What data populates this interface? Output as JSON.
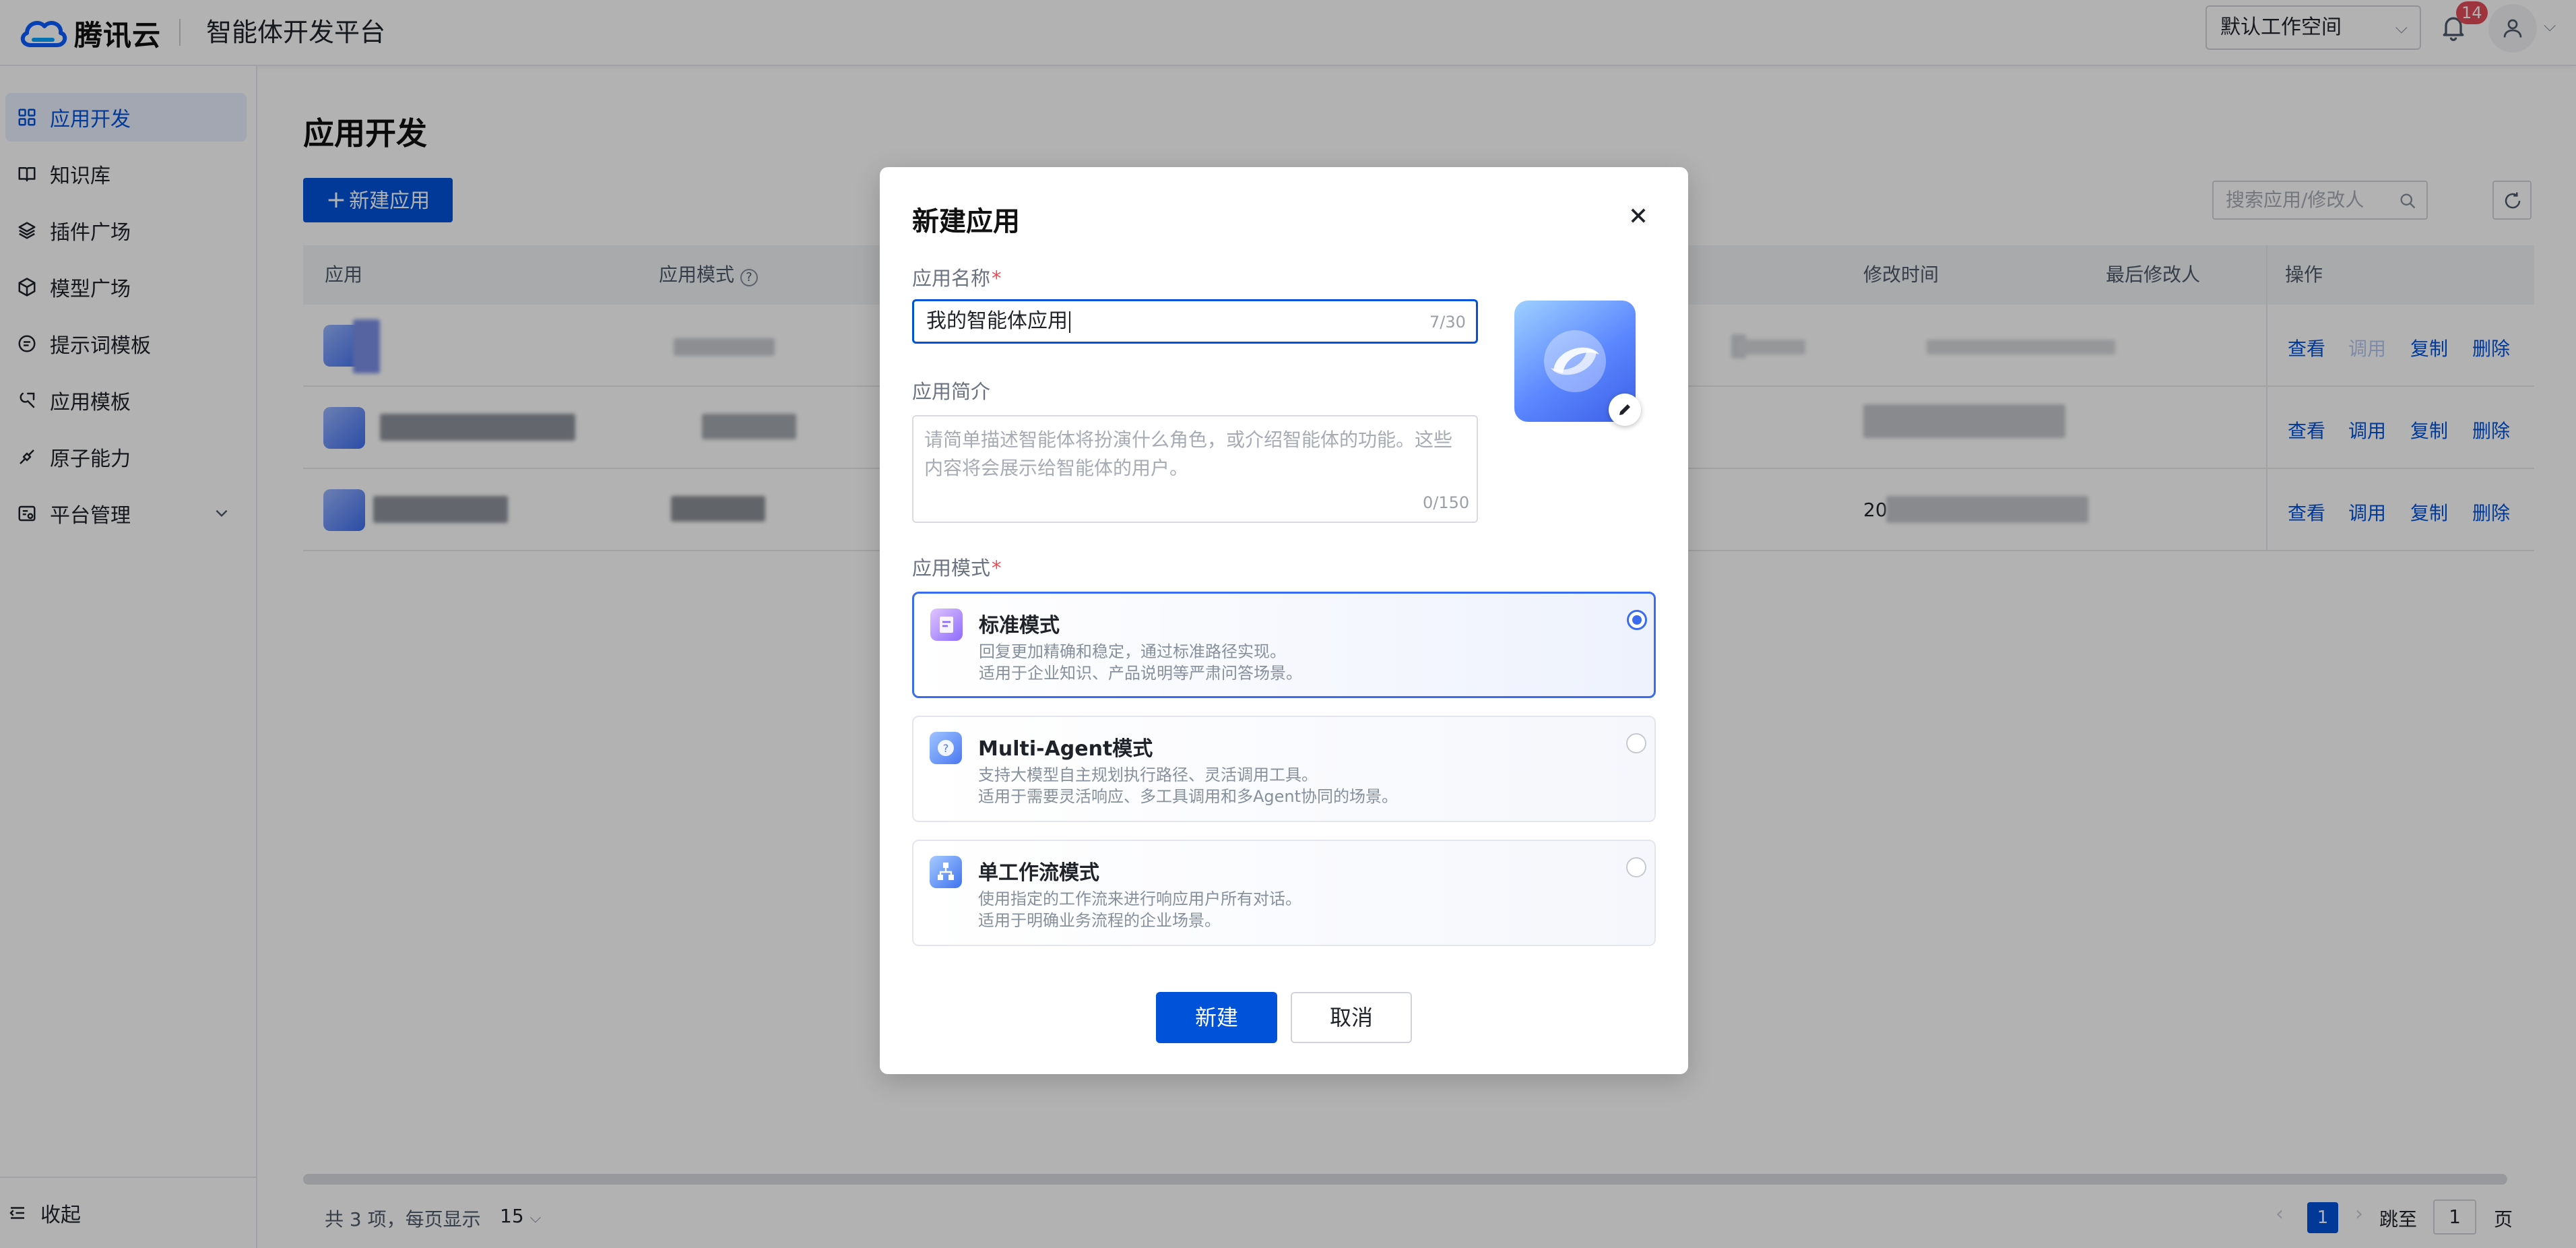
{
  "header": {
    "brand": "腾讯云",
    "platform_title": "智能体开发平台",
    "workspace": "默认工作空间",
    "notification_count": "14"
  },
  "sidebar": {
    "items": [
      {
        "label": "应用开发",
        "icon": "grid-icon",
        "active": true
      },
      {
        "label": "知识库",
        "icon": "book-icon"
      },
      {
        "label": "插件广场",
        "icon": "layers-icon"
      },
      {
        "label": "模型广场",
        "icon": "cube-icon"
      },
      {
        "label": "提示词模板",
        "icon": "chat-icon"
      },
      {
        "label": "应用模板",
        "icon": "template-icon"
      },
      {
        "label": "原子能力",
        "icon": "atom-icon"
      },
      {
        "label": "平台管理",
        "icon": "settings-icon"
      }
    ],
    "collapse_label": "收起"
  },
  "main": {
    "title": "应用开发",
    "new_app_button": "新建应用",
    "search_placeholder": "搜索应用/修改人",
    "columns": [
      "应用",
      "应用模式",
      "修改时间",
      "最后修改人",
      "操作"
    ],
    "row_ops": [
      [
        "查看",
        "调用",
        "复制",
        "删除"
      ],
      [
        "查看",
        "调用",
        "复制",
        "删除"
      ],
      [
        "查看",
        "调用",
        "复制",
        "删除"
      ]
    ],
    "row3_time_prefix": "20",
    "pagination": {
      "summary": "共 3 项，每页显示",
      "page_size": "15",
      "current_page": "1",
      "jump_label": "跳至",
      "jump_value": "1",
      "page_unit": "页"
    }
  },
  "modal": {
    "title": "新建应用",
    "name_label": "应用名称",
    "name_value": "我的智能体应用",
    "name_counter": "7/30",
    "desc_label": "应用简介",
    "desc_placeholder": "请简单描述智能体将扮演什么角色，或介绍智能体的功能。这些内容将会展示给智能体的用户。",
    "desc_counter": "0/150",
    "mode_label": "应用模式",
    "modes": [
      {
        "name": "标准模式",
        "line1": "回复更加精确和稳定，通过标准路径实现。",
        "line2": "适用于企业知识、产品说明等严肃问答场景。",
        "selected": true
      },
      {
        "name": "Multi-Agent模式",
        "line1": "支持大模型自主规划执行路径、灵活调用工具。",
        "line2": "适用于需要灵活响应、多工具调用和多Agent协同的场景。",
        "selected": false
      },
      {
        "name": "单工作流模式",
        "line1": "使用指定的工作流来进行响应用户所有对话。",
        "line2": "适用于明确业务流程的企业场景。",
        "selected": false
      }
    ],
    "confirm_label": "新建",
    "cancel_label": "取消"
  },
  "colors": {
    "primary": "#0052d9",
    "badge": "#e34d59",
    "selected_border": "#3b6cf0"
  }
}
